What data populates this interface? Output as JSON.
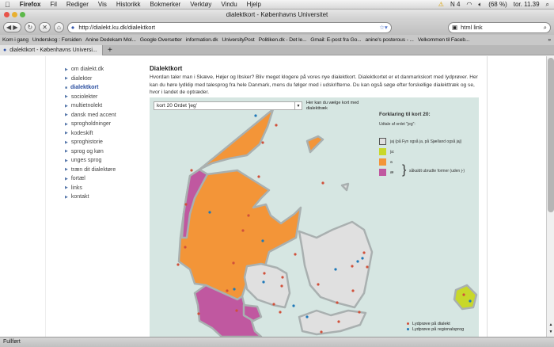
{
  "menubar": {
    "app": "Firefox",
    "items": [
      "Fil",
      "Rediger",
      "Vis",
      "Historikk",
      "Bokmerker",
      "Verktøy",
      "Vindu",
      "Hjelp"
    ],
    "status": [
      "N 4",
      "(68 %)",
      "tor. 11.39"
    ]
  },
  "window": {
    "title": "dialektkort - Københavns Universitet"
  },
  "toolbar": {
    "url": "http://dialekt.ku.dk/dialektkort",
    "search": "html link"
  },
  "bookmarks": [
    "Kom i gang",
    "Underskog : Forsiden",
    "Anine Dedekam Mol...",
    "Google Oversetter",
    "information.dk",
    "UniversityPost",
    "Politiken.dk - Det le...",
    "Gmail: E-post fra Go...",
    "anine's posterous - ...",
    "Velkommen til Faceb..."
  ],
  "tab": {
    "label": "dialektkort - Københavns Universi..."
  },
  "nav": [
    "om dialekt.dk",
    "dialekter",
    "dialektkort",
    "sociolekter",
    "multietnolekt",
    "dansk med accent",
    "sprogholdninger",
    "kodeskift",
    "sproghistorie",
    "sprog og køn",
    "unges sprog",
    "træn dit dialektøre",
    "fortæl",
    "links",
    "kontakt"
  ],
  "nav_active": "dialektkort",
  "page": {
    "title": "Dialektkort",
    "intro": "Hvordan taler man i Skæve, Højer og Ibsker? Bliv meget klogere på vores nye dialektkort. Dialektkortet er et danmarkskort med lydprøver. Her kan du høre lydklip med talesprog fra hele Danmark, mens du følger med i udskrifterne. Du kan også søge efter forskellige dialekttræk og se, hvor i landet de optræder."
  },
  "map": {
    "select_value": "kort 20 Ordet 'jeg'",
    "hint": "Her kan du vælge kort med dialekttræk",
    "legend_title": "Forklaring til kort 20:",
    "legend_sub": "Udtale af ordet \"jeg\":",
    "legend": [
      {
        "label": "jaj (på Fyn også ja, på Sjælland også jaj)",
        "color": "#e0e0e0"
      },
      {
        "label": "ja:",
        "color": "#c8d82a"
      },
      {
        "label": "a",
        "color": "#f39538"
      },
      {
        "label": "æ",
        "color": "#c058a0"
      }
    ],
    "brace_label": "såkaldt ubrudte former (uden j-)",
    "dot_legend": [
      {
        "label": "Lydprøve på dialekt",
        "color": "#d0503a"
      },
      {
        "label": "Lydprøve på regionalsprog",
        "color": "#1e78b8"
      }
    ]
  },
  "status": "Fullført"
}
